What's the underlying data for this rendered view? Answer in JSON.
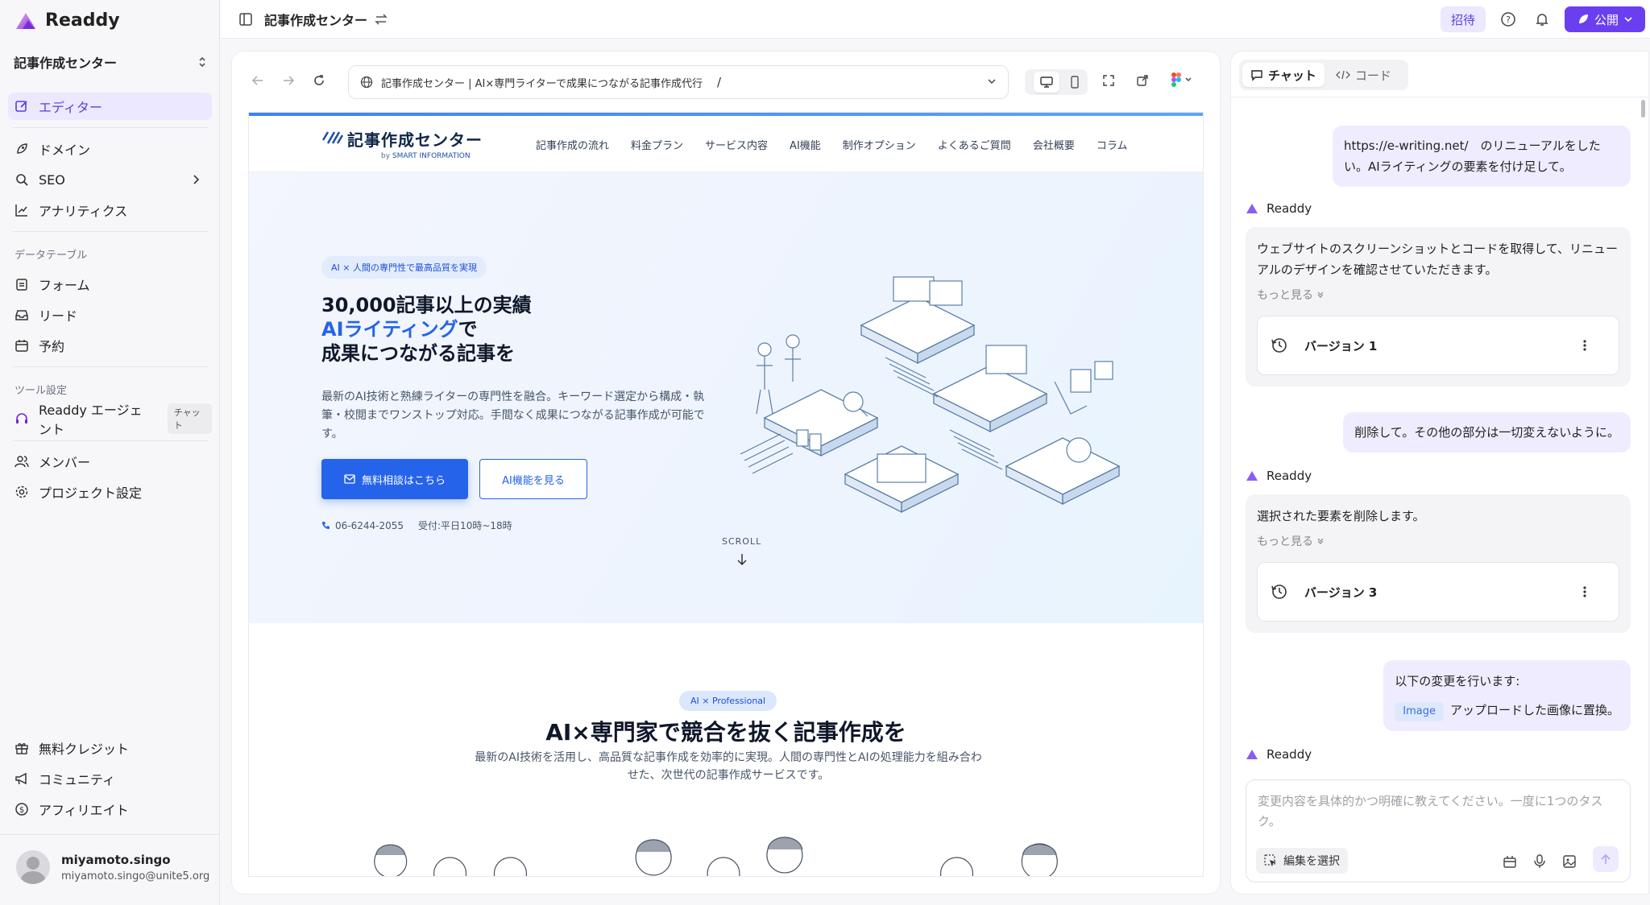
{
  "app": {
    "name": "Readdy",
    "project_name": "記事作成センター"
  },
  "sidebar": {
    "items_main": [
      {
        "label": "エディター"
      },
      {
        "label": "ドメイン"
      },
      {
        "label": "SEO"
      },
      {
        "label": "アナリティクス"
      }
    ],
    "section_data": "データテーブル",
    "items_data": [
      {
        "label": "フォーム"
      },
      {
        "label": "リード"
      },
      {
        "label": "予約"
      }
    ],
    "section_tools": "ツール設定",
    "agent_label": "Readdy エージェント",
    "agent_badge": "チャット",
    "items_settings": [
      {
        "label": "メンバー"
      },
      {
        "label": "プロジェクト設定"
      }
    ],
    "items_bottom": [
      {
        "label": "無料クレジット"
      },
      {
        "label": "コミュニティ"
      },
      {
        "label": "アフィリエイト"
      }
    ],
    "user": {
      "name": "miyamoto.singo",
      "email": "miyamoto.singo@unite5.org"
    }
  },
  "topbar": {
    "title": "記事作成センター",
    "invite_label": "招待",
    "publish_label": "公開"
  },
  "preview": {
    "url_title": "記事作成センター | AI×専門ライターで成果につながる記事作成代行",
    "url_path": "/"
  },
  "site": {
    "brand": "記事作成センター",
    "brand_by": "by",
    "brand_sub": "SMART INFORMATION",
    "nav": [
      "記事作成の流れ",
      "料金プラン",
      "サービス内容",
      "AI機能",
      "制作オプション",
      "よくあるご質問",
      "会社概要",
      "コラム"
    ],
    "hero_pill": "AI × 人間の専門性で最高品質を実現",
    "hero_line1": "30,000記事以上の実績",
    "hero_line2_blue": "AIライティング",
    "hero_line2_rest": "で",
    "hero_line3": "成果につながる記事を",
    "hero_desc": "最新のAI技術と熟練ライターの専門性を融合。キーワード選定から構成・執筆・校閲までワンストップ対応。手間なく成果につながる記事作成が可能です。",
    "cta_primary": "無料相談はこちら",
    "cta_secondary": "AI機能を見る",
    "tel": "06-6244-2055",
    "hours": "受付:平日10時~18時",
    "scroll": "SCROLL",
    "sec2_pill": "AI × Professional",
    "sec2_title": "AI×専門家で競合を抜く記事作成を",
    "sec2_desc": "最新のAI技術を活用し、高品質な記事作成を効率的に実現。人間の専門性とAIの処理能力を組み合わせた、次世代の記事作成サービスです。"
  },
  "chat": {
    "tab_chat": "チャット",
    "tab_code": "コード",
    "agent_name": "Readdy",
    "messages": [
      {
        "role": "user",
        "text": "https://e-writing.net/　のリニューアルをしたい。AIライティングの要素を付け足して。"
      },
      {
        "role": "agent",
        "text": "ウェブサイトのスクリーンショットとコードを取得して、リニューアルのデザインを確認させていただきます。",
        "more": "もっと見る",
        "version": "バージョン 1"
      },
      {
        "role": "user",
        "text": "削除して。その他の部分は一切変えないように。"
      },
      {
        "role": "agent",
        "text": "選択された要素を削除します。",
        "more": "もっと見る",
        "version": "バージョン 3"
      },
      {
        "role": "user",
        "text": "以下の変更を行います:",
        "tag": "Image",
        "tag_text": "アップロードした画像に置換。"
      }
    ],
    "composer_placeholder": "変更内容を具体的かつ明確に教えてください。一度に1つのタスク。",
    "select_edit_label": "編集を選択"
  },
  "colors": {
    "accent": "#6a3ff0",
    "accent_soft": "#ece8ff",
    "site_blue": "#2563eb"
  }
}
